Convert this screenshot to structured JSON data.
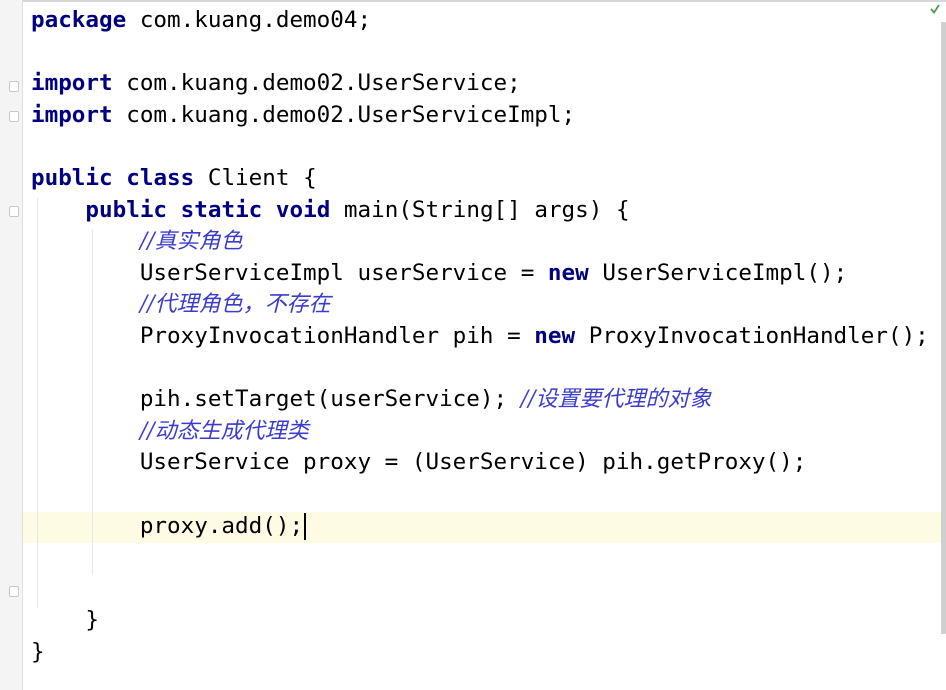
{
  "editor": {
    "lines": [
      [
        {
          "t": "package",
          "k": "kw"
        },
        {
          "t": " com.kuang.demo04;"
        }
      ],
      [],
      [
        {
          "t": "import",
          "k": "kw"
        },
        {
          "t": " com.kuang.demo02.UserService;"
        }
      ],
      [
        {
          "t": "import",
          "k": "kw"
        },
        {
          "t": " com.kuang.demo02.UserServiceImpl;"
        }
      ],
      [],
      [
        {
          "t": "public",
          "k": "kw"
        },
        {
          "t": " "
        },
        {
          "t": "class",
          "k": "kw"
        },
        {
          "t": " Client {"
        }
      ],
      [
        {
          "t": "    "
        },
        {
          "t": "public",
          "k": "kw"
        },
        {
          "t": " "
        },
        {
          "t": "static",
          "k": "kw"
        },
        {
          "t": " "
        },
        {
          "t": "void",
          "k": "kw"
        },
        {
          "t": " main(String[] args) {"
        }
      ],
      [
        {
          "t": "        "
        },
        {
          "t": "//真实角色",
          "k": "cm"
        }
      ],
      [
        {
          "t": "        UserServiceImpl userService = "
        },
        {
          "t": "new",
          "k": "kw"
        },
        {
          "t": " UserServiceImpl();"
        }
      ],
      [
        {
          "t": "        "
        },
        {
          "t": "//代理角色，不存在",
          "k": "cm"
        }
      ],
      [
        {
          "t": "        ProxyInvocationHandler pih = "
        },
        {
          "t": "new",
          "k": "kw"
        },
        {
          "t": " ProxyInvocationHandler();"
        }
      ],
      [],
      [
        {
          "t": "        pih.setTarget(userService); "
        },
        {
          "t": "//设置要代理的对象",
          "k": "cm"
        }
      ],
      [
        {
          "t": "        "
        },
        {
          "t": "//动态生成代理类",
          "k": "cm"
        }
      ],
      [
        {
          "t": "        UserService proxy = (UserService) pih.getProxy();"
        }
      ],
      [],
      [
        {
          "t": "        proxy.add();"
        }
      ],
      [],
      [],
      [
        {
          "t": "    }"
        }
      ],
      [
        {
          "t": "}"
        }
      ]
    ],
    "caret_line": 16,
    "colors": {
      "keyword": "#000080",
      "comment": "#3c3ccc",
      "text": "#000000",
      "current_line": "#fdfbe4"
    },
    "status_icon": "check-icon"
  }
}
